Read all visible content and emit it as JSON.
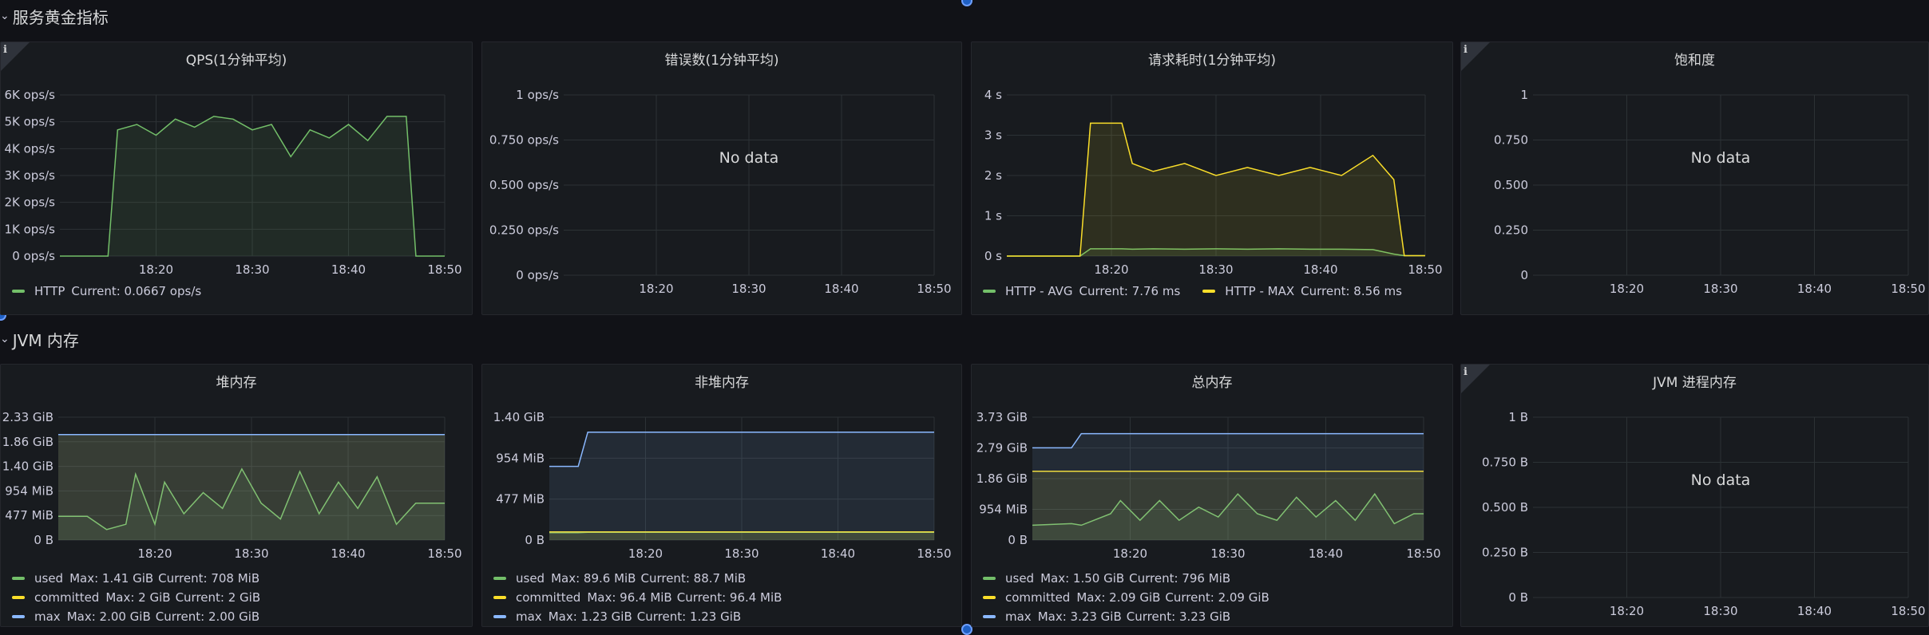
{
  "rows": [
    {
      "title": "服务黄金指标"
    },
    {
      "title": "JVM 内存"
    }
  ],
  "colors": {
    "green": "#73bf69",
    "yellow": "#fade2a",
    "blue": "#8ab8ff",
    "grid": "#2c3235"
  },
  "panels": [
    {
      "id": "qps",
      "title": "QPS(1分钟平均)",
      "info": true,
      "no_data": "",
      "y_ticks": [
        "6K ops/s",
        "5K ops/s",
        "4K ops/s",
        "3K ops/s",
        "2K ops/s",
        "1K ops/s",
        "0 ops/s"
      ],
      "x_ticks": [
        "18:20",
        "18:30",
        "18:40",
        "18:50"
      ],
      "legend": [
        [
          {
            "name": "HTTP",
            "stats": [
              "Current: 0.0667 ops/s"
            ],
            "color": "#73bf69"
          }
        ]
      ]
    },
    {
      "id": "errors",
      "title": "错误数(1分钟平均)",
      "info": false,
      "no_data": "No data",
      "y_ticks": [
        "1 ops/s",
        "0.750 ops/s",
        "0.500 ops/s",
        "0.250 ops/s",
        "0 ops/s"
      ],
      "x_ticks": [
        "18:20",
        "18:30",
        "18:40",
        "18:50"
      ],
      "legend": []
    },
    {
      "id": "latency",
      "title": "请求耗时(1分钟平均)",
      "info": false,
      "no_data": "",
      "y_ticks": [
        "4 s",
        "3 s",
        "2 s",
        "1 s",
        "0 s"
      ],
      "x_ticks": [
        "18:20",
        "18:30",
        "18:40",
        "18:50"
      ],
      "legend": [
        [
          {
            "name": "HTTP - AVG",
            "stats": [
              "Current: 7.76 ms"
            ],
            "color": "#73bf69"
          },
          {
            "name": "HTTP - MAX",
            "stats": [
              "Current: 8.56 ms"
            ],
            "color": "#fade2a"
          }
        ]
      ]
    },
    {
      "id": "saturation",
      "title": "饱和度",
      "info": true,
      "no_data": "No data",
      "y_ticks": [
        "1",
        "0.750",
        "0.500",
        "0.250",
        "0"
      ],
      "x_ticks": [
        "18:20",
        "18:30",
        "18:40",
        "18:50"
      ],
      "legend": []
    },
    {
      "id": "heap",
      "title": "堆内存",
      "info": false,
      "no_data": "",
      "y_ticks": [
        "2.33 GiB",
        "1.86 GiB",
        "1.40 GiB",
        "954 MiB",
        "477 MiB",
        "0 B"
      ],
      "x_ticks": [
        "18:20",
        "18:30",
        "18:40",
        "18:50"
      ],
      "legend": [
        [
          {
            "name": "used",
            "stats": [
              "Max: 1.41 GiB",
              "Current: 708 MiB"
            ],
            "color": "#73bf69"
          }
        ],
        [
          {
            "name": "committed",
            "stats": [
              "Max: 2 GiB",
              "Current: 2 GiB"
            ],
            "color": "#fade2a"
          }
        ],
        [
          {
            "name": "max",
            "stats": [
              "Max: 2.00 GiB",
              "Current: 2.00 GiB"
            ],
            "color": "#8ab8ff"
          }
        ]
      ]
    },
    {
      "id": "nonheap",
      "title": "非堆内存",
      "info": false,
      "no_data": "",
      "y_ticks": [
        "1.40 GiB",
        "954 MiB",
        "477 MiB",
        "0 B"
      ],
      "x_ticks": [
        "18:20",
        "18:30",
        "18:40",
        "18:50"
      ],
      "legend": [
        [
          {
            "name": "used",
            "stats": [
              "Max: 89.6 MiB",
              "Current: 88.7 MiB"
            ],
            "color": "#73bf69"
          }
        ],
        [
          {
            "name": "committed",
            "stats": [
              "Max: 96.4 MiB",
              "Current: 96.4 MiB"
            ],
            "color": "#fade2a"
          }
        ],
        [
          {
            "name": "max",
            "stats": [
              "Max: 1.23 GiB",
              "Current: 1.23 GiB"
            ],
            "color": "#8ab8ff"
          }
        ]
      ]
    },
    {
      "id": "total",
      "title": "总内存",
      "info": false,
      "no_data": "",
      "y_ticks": [
        "3.73 GiB",
        "2.79 GiB",
        "1.86 GiB",
        "954 MiB",
        "0 B"
      ],
      "x_ticks": [
        "18:20",
        "18:30",
        "18:40",
        "18:50"
      ],
      "legend": [
        [
          {
            "name": "used",
            "stats": [
              "Max: 1.50 GiB",
              "Current: 796 MiB"
            ],
            "color": "#73bf69"
          }
        ],
        [
          {
            "name": "committed",
            "stats": [
              "Max: 2.09 GiB",
              "Current: 2.09 GiB"
            ],
            "color": "#fade2a"
          }
        ],
        [
          {
            "name": "max",
            "stats": [
              "Max: 3.23 GiB",
              "Current: 3.23 GiB"
            ],
            "color": "#8ab8ff"
          }
        ]
      ]
    },
    {
      "id": "jvmproc",
      "title": "JVM 进程内存",
      "info": true,
      "no_data": "No data",
      "y_ticks": [
        "1 B",
        "0.750 B",
        "0.500 B",
        "0.250 B",
        "0 B"
      ],
      "x_ticks": [
        "18:20",
        "18:30",
        "18:40",
        "18:50"
      ],
      "legend": []
    }
  ],
  "chart_data": [
    {
      "type": "line",
      "panel": "qps",
      "y_unit": "ops/s",
      "ylim": [
        0,
        6000
      ],
      "x": [
        "18:10",
        "18:14",
        "18:15",
        "18:16",
        "18:18",
        "18:20",
        "18:22",
        "18:24",
        "18:26",
        "18:28",
        "18:30",
        "18:32",
        "18:34",
        "18:36",
        "18:38",
        "18:40",
        "18:42",
        "18:44",
        "18:46",
        "18:47",
        "18:48",
        "18:50"
      ],
      "series": [
        {
          "name": "HTTP",
          "values": [
            0,
            0,
            0,
            4700,
            4900,
            4500,
            5100,
            4800,
            5200,
            5100,
            4700,
            4900,
            3700,
            4700,
            4400,
            4900,
            4300,
            5200,
            5200,
            0,
            0,
            0
          ]
        }
      ]
    },
    {
      "type": "line",
      "panel": "latency",
      "y_unit": "s",
      "ylim": [
        0,
        4
      ],
      "x": [
        "18:10",
        "18:17",
        "18:18",
        "18:21",
        "18:22",
        "18:24",
        "18:27",
        "18:30",
        "18:33",
        "18:36",
        "18:39",
        "18:42",
        "18:45",
        "18:47",
        "18:48",
        "18:50"
      ],
      "series": [
        {
          "name": "HTTP - AVG",
          "values": [
            0,
            0,
            0.18,
            0.18,
            0.17,
            0.18,
            0.17,
            0.18,
            0.17,
            0.18,
            0.17,
            0.17,
            0.16,
            0.05,
            0.01,
            0.01
          ]
        },
        {
          "name": "HTTP - MAX",
          "values": [
            0,
            0,
            3.3,
            3.3,
            2.3,
            2.1,
            2.3,
            2.0,
            2.2,
            2.0,
            2.2,
            2.0,
            2.5,
            1.9,
            0.01,
            0.01
          ]
        }
      ]
    },
    {
      "type": "line",
      "panel": "heap",
      "y_unit": "GiB",
      "ylim": [
        0,
        2.33
      ],
      "x": [
        "18:10",
        "18:13",
        "18:15",
        "18:17",
        "18:18",
        "18:20",
        "18:21",
        "18:23",
        "18:25",
        "18:27",
        "18:29",
        "18:31",
        "18:33",
        "18:35",
        "18:37",
        "18:39",
        "18:41",
        "18:43",
        "18:45",
        "18:47",
        "18:49",
        "18:50"
      ],
      "series": [
        {
          "name": "used",
          "values": [
            0.45,
            0.45,
            0.2,
            0.3,
            1.25,
            0.3,
            1.1,
            0.5,
            0.9,
            0.6,
            1.35,
            0.7,
            0.4,
            1.3,
            0.5,
            1.1,
            0.6,
            1.2,
            0.3,
            0.7,
            0.7,
            0.7
          ],
          "color": "#73bf69"
        },
        {
          "name": "committed",
          "values": [
            2.0,
            2.0,
            2.0,
            2.0,
            2.0,
            2.0,
            2.0,
            2.0,
            2.0,
            2.0,
            2.0,
            2.0,
            2.0,
            2.0,
            2.0,
            2.0,
            2.0,
            2.0,
            2.0,
            2.0,
            2.0,
            2.0
          ],
          "color": "#fade2a"
        },
        {
          "name": "max",
          "values": [
            2.0,
            2.0,
            2.0,
            2.0,
            2.0,
            2.0,
            2.0,
            2.0,
            2.0,
            2.0,
            2.0,
            2.0,
            2.0,
            2.0,
            2.0,
            2.0,
            2.0,
            2.0,
            2.0,
            2.0,
            2.0,
            2.0
          ],
          "color": "#8ab8ff"
        }
      ]
    },
    {
      "type": "line",
      "panel": "nonheap",
      "y_unit": "GiB",
      "ylim": [
        0,
        1.4
      ],
      "x": [
        "18:10",
        "18:13",
        "18:14",
        "18:20",
        "18:30",
        "18:40",
        "18:50"
      ],
      "series": [
        {
          "name": "used",
          "values": [
            0.085,
            0.085,
            0.088,
            0.088,
            0.088,
            0.088,
            0.088
          ],
          "color": "#73bf69"
        },
        {
          "name": "committed",
          "values": [
            0.094,
            0.094,
            0.094,
            0.094,
            0.094,
            0.094,
            0.094
          ],
          "color": "#fade2a"
        },
        {
          "name": "max",
          "values": [
            0.84,
            0.84,
            1.23,
            1.23,
            1.23,
            1.23,
            1.23
          ],
          "color": "#8ab8ff"
        }
      ]
    },
    {
      "type": "line",
      "panel": "total",
      "y_unit": "GiB",
      "ylim": [
        0,
        3.73
      ],
      "x": [
        "18:10",
        "18:14",
        "18:15",
        "18:18",
        "18:19",
        "18:21",
        "18:23",
        "18:25",
        "18:27",
        "18:29",
        "18:31",
        "18:33",
        "18:35",
        "18:37",
        "18:39",
        "18:41",
        "18:43",
        "18:45",
        "18:47",
        "18:49",
        "18:50"
      ],
      "series": [
        {
          "name": "used",
          "values": [
            0.45,
            0.5,
            0.45,
            0.8,
            1.2,
            0.6,
            1.2,
            0.6,
            1.0,
            0.7,
            1.4,
            0.8,
            0.6,
            1.3,
            0.7,
            1.2,
            0.6,
            1.4,
            0.5,
            0.8,
            0.8
          ],
          "color": "#73bf69"
        },
        {
          "name": "committed",
          "values": [
            2.09,
            2.09,
            2.09,
            2.09,
            2.09,
            2.09,
            2.09,
            2.09,
            2.09,
            2.09,
            2.09,
            2.09,
            2.09,
            2.09,
            2.09,
            2.09,
            2.09,
            2.09,
            2.09,
            2.09,
            2.09
          ],
          "color": "#fade2a"
        },
        {
          "name": "max",
          "values": [
            2.8,
            2.8,
            3.23,
            3.23,
            3.23,
            3.23,
            3.23,
            3.23,
            3.23,
            3.23,
            3.23,
            3.23,
            3.23,
            3.23,
            3.23,
            3.23,
            3.23,
            3.23,
            3.23,
            3.23,
            3.23
          ],
          "color": "#8ab8ff"
        }
      ]
    }
  ]
}
